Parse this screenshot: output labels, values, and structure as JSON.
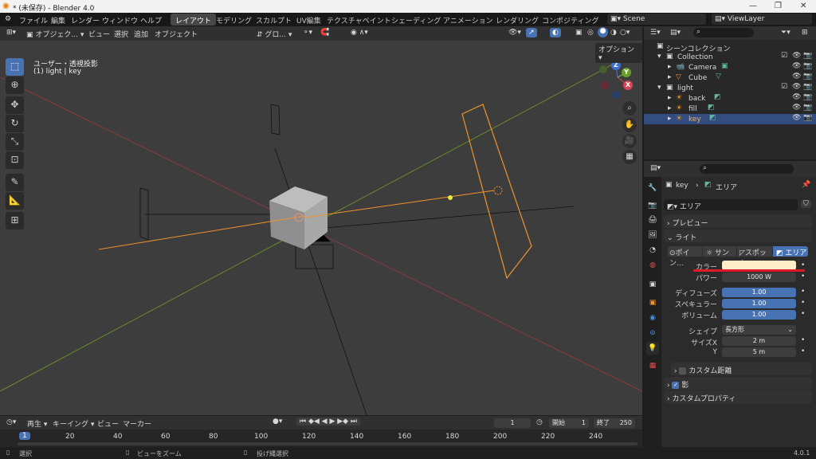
{
  "titlebar": {
    "title": "* (未保存) - Blender 4.0"
  },
  "menu": [
    "ファイル",
    "編集",
    "レンダー",
    "ウィンドウ",
    "ヘルプ"
  ],
  "workspaces": [
    "レイアウト",
    "モデリング",
    "スカルプト",
    "UV編集",
    "テクスチャペイント",
    "シェーディング",
    "アニメーション",
    "レンダリング",
    "コンポジティング"
  ],
  "scene": "Scene",
  "viewlayer": "ViewLayer",
  "viewport_header": {
    "mode": "オブジェク...",
    "menus": [
      "ビュー",
      "選択",
      "追加",
      "オブジェクト"
    ],
    "transform": "グロ..."
  },
  "viewport": {
    "view_name": "ユーザー・透視投影",
    "object_info": "(1) light | key",
    "options": "オプション",
    "axis_x": "X",
    "axis_y": "Y",
    "axis_z": "Z"
  },
  "outliner": {
    "scene_collection": "シーンコレクション",
    "items": [
      {
        "label": "Collection"
      },
      {
        "label": "Camera"
      },
      {
        "label": "Cube"
      },
      {
        "label": "light"
      },
      {
        "label": "back"
      },
      {
        "label": "fill"
      },
      {
        "label": "key"
      }
    ]
  },
  "properties": {
    "object": "key",
    "data": "エリア",
    "data_name": "エリア",
    "preview": "プレビュー",
    "light": "ライト",
    "light_types": [
      "ポイン...",
      "サン",
      "スポット",
      "エリア"
    ],
    "color_label": "カラー",
    "color_value": "#ffecc8",
    "power_label": "パワー",
    "power_value": "1000 W",
    "diffuse_label": "ディフューズ",
    "diffuse_value": "1.00",
    "specular_label": "スペキュラー",
    "specular_value": "1.00",
    "volume_label": "ボリューム",
    "volume_value": "1.00",
    "shape_label": "シェイプ",
    "shape_value": "長方形",
    "sizex_label": "サイズX",
    "sizex_value": "2 m",
    "y_label": "Y",
    "y_value": "5 m",
    "custom_distance": "カスタム距離",
    "shadow": "影",
    "custom_props": "カスタムプロパティ"
  },
  "timeline": {
    "menus": [
      "再生",
      "キーイング",
      "ビュー",
      "マーカー"
    ],
    "current": "1",
    "start_label": "開始",
    "start": "1",
    "end_label": "終了",
    "end": "250",
    "ticks": [
      "1",
      "20",
      "40",
      "60",
      "80",
      "100",
      "120",
      "140",
      "160",
      "180",
      "200",
      "220",
      "240"
    ]
  },
  "status": {
    "select": "選択",
    "zoom": "ビューをズーム",
    "lasso": "投げ縄選択",
    "version": "4.0.1"
  },
  "colors": {
    "accent": "#4772b3",
    "orange": "#f0922c",
    "red_underline": "#e0192a"
  }
}
